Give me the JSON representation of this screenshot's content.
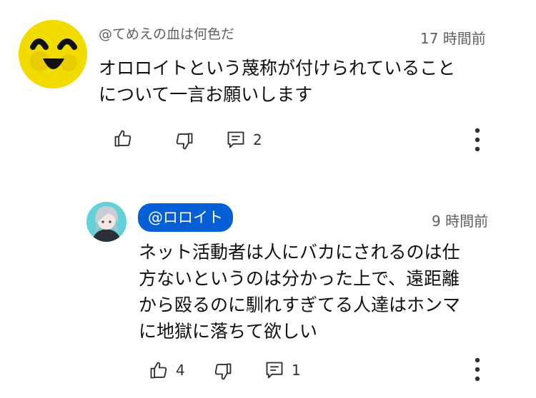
{
  "comments": [
    {
      "handle": "@てめえの血は何色だ",
      "time": "17 時間前",
      "body": "オロロイトという蔑称が付けられていること\nについて一言お願いします",
      "likes": "",
      "replies": "2",
      "avatar": "yellow-smiley-avatar"
    },
    {
      "handle": "@ロロイト",
      "time": "9 時間前",
      "body": "ネット活動者は人にバカにされるのは仕\n方ないというのは分かった上で、遠距離\nから殴るのに馴れすぎてる人達はホンマ\nに地獄に落ちて欲しい",
      "likes": "4",
      "replies": "1",
      "avatar": "anime-character-avatar"
    }
  ],
  "colors": {
    "handle_pill": "#065fd4",
    "secondary_text": "#606060"
  },
  "icons": [
    "like-icon",
    "dislike-icon",
    "reply-icon",
    "more-icon"
  ]
}
